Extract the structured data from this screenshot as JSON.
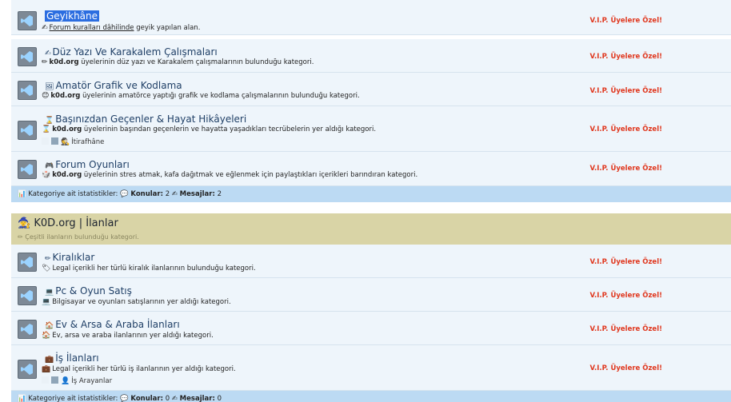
{
  "category1": {
    "forums": [
      {
        "title": "Geyikhâne",
        "selected": true,
        "desc_parts": [
          {
            "t": "Forum kuralları dâhilinde",
            "u": true
          },
          {
            "t": " geyik yapılan alan."
          }
        ],
        "emoji": "✍",
        "vip": "V.I.P. Üyelere Özel!"
      },
      {
        "title": "Düz Yazı Ve Karakalem Çalışmaları",
        "emoji_title": "✍",
        "desc_parts": [
          {
            "t": "k0d.org",
            "b": true
          },
          {
            "t": " üyelerinin düz yazı ve Karakalem çalışmalarının bulunduğu kategori."
          }
        ],
        "emoji": "✏",
        "vip": "V.I.P. Üyelere Özel!"
      },
      {
        "title": "Amatör Grafik ve Kodlama",
        "emoji_title": "🖼",
        "desc_parts": [
          {
            "t": "k0d.org",
            "b": true
          },
          {
            "t": " üyelerinin amatörce yaptığı grafik ve kodlama çalışmalarının bulunduğu kategori."
          }
        ],
        "emoji": "😊",
        "vip": "V.I.P. Üyelere Özel!"
      },
      {
        "title": "Başınızdan Geçenler & Hayat Hikâyeleri",
        "emoji_title": "⌛",
        "desc_parts": [
          {
            "t": "k0d.org",
            "b": true
          },
          {
            "t": " üyelerinin başından geçenlerin ve hayatta yaşadıkları tecrübelerin yer aldığı kategori."
          }
        ],
        "emoji": "⌛",
        "vip": "V.I.P. Üyelere Özel!",
        "subforum": "İtirafhâne"
      },
      {
        "title": "Forum Oyunları",
        "emoji_title": "🎮",
        "desc_parts": [
          {
            "t": "k0d.org",
            "b": true
          },
          {
            "t": " üyelerinin stres atmak, kafa dağıtmak ve eğlenmek için paylaştıkları içerikleri barındıran kategori."
          }
        ],
        "emoji": "🎲",
        "vip": "V.I.P. Üyelere Özel!"
      }
    ],
    "stats": {
      "label": "Kategoriye ait istatistikler:",
      "topics_label": "Konular:",
      "topics": "2",
      "posts_label": "Mesajlar:",
      "posts": "2"
    }
  },
  "category2": {
    "title": "K0D.org | İlanlar",
    "desc": "Çeşitli ilanların bulunduğu kategori.",
    "forums": [
      {
        "title": "Kiralıklar",
        "emoji_title": "✏",
        "desc_parts": [
          {
            "t": "Legal içerikli her türlü kiralık ilanlarının bulunduğu kategori."
          }
        ],
        "emoji": "🏷",
        "vip": "V.I.P. Üyelere Özel!"
      },
      {
        "title": "Pc & Oyun Satış",
        "emoji_title": "💻",
        "desc_parts": [
          {
            "t": "Bilgisayar ve oyunları satışlarının yer aldığı kategori."
          }
        ],
        "emoji": "💻",
        "vip": "V.I.P. Üyelere Özel!"
      },
      {
        "title": "Ev & Arsa & Araba İlanları",
        "emoji_title": "🏠",
        "desc_parts": [
          {
            "t": "Ev, arsa ve araba ilanlarının yer aldığı kategori."
          }
        ],
        "emoji": "🏠",
        "vip": "V.I.P. Üyelere Özel!"
      },
      {
        "title": "İş İlanları",
        "emoji_title": "💼",
        "desc_parts": [
          {
            "t": "Legal içerikli her türlü iş ilanlarının yer aldığı kategori."
          }
        ],
        "emoji": "💼",
        "vip": "V.I.P. Üyelere Özel!",
        "subforum": "İş Arayanlar"
      }
    ],
    "stats": {
      "label": "Kategoriye ait istatistikler:",
      "topics_label": "Konular:",
      "topics": "0",
      "posts_label": "Mesajlar:",
      "posts": "0"
    }
  },
  "colors": {
    "vip": "#e0381f",
    "row_bg": "#eef5fb",
    "stats_bg": "#bcdaf3",
    "category_header_bg": "#d9d4a6",
    "title": "#1f3f66"
  }
}
